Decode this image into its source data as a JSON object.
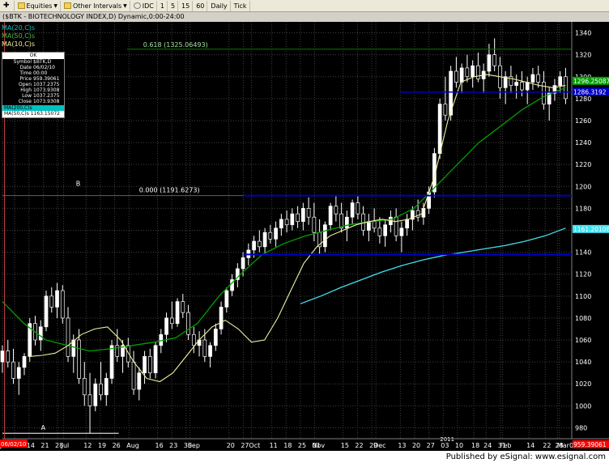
{
  "toolbar": {
    "items": [
      {
        "label": "",
        "icon": "plus-icon"
      },
      {
        "label": "Equities",
        "icon": "folder-icon"
      },
      {
        "label": "Other Intervals",
        "icon": "folder-icon"
      },
      {
        "label": "IDC",
        "icon": "settings-icon"
      },
      {
        "label": "1"
      },
      {
        "label": "5"
      },
      {
        "label": "15"
      },
      {
        "label": "60"
      },
      {
        "label": "Daily"
      },
      {
        "label": "Tick"
      }
    ]
  },
  "window": {
    "title": "($BTK - BIOTECHNOLOGY INDEX,D) Dynamic,0:00-24:00"
  },
  "legend": {
    "ma20": "MA(20,C)s",
    "ma50": "MA(50,C)s",
    "ma10": "MA(10,C)s"
  },
  "data_window": {
    "header": "OK",
    "rows": [
      {
        "k": "Symbol",
        "v": "$BTK,D"
      },
      {
        "k": "Date",
        "v": "06/02/10"
      },
      {
        "k": "Time",
        "v": "00:00"
      },
      {
        "k": "Price",
        "v": "959.39061"
      },
      {
        "k": "Open",
        "v": "1037.2375"
      },
      {
        "k": "High",
        "v": "1073.9308"
      },
      {
        "k": "Low",
        "v": "1037.2375"
      },
      {
        "k": "Close",
        "v": "1073.9308"
      }
    ],
    "ma50_head": "MA(200,C)s",
    "ma50_row": "MA(50,C)s  1163.15072"
  },
  "footer": {
    "text": "Published by eSignal: www.esignal.com"
  },
  "colors": {
    "background": "#000000",
    "grid": "#404040",
    "candle_up": "#ffffff",
    "candle_down": "#000000",
    "wick": "#ffffff",
    "ma10": "#f0f0a0",
    "ma50": "#00a000",
    "ma200": "#40e0f0",
    "fib_line": "#008000",
    "support_line": "#0000c0",
    "price_tag": "#ff0000"
  },
  "chart_data": {
    "type": "candlestick",
    "title": "$BTK - BIOTECHNOLOGY INDEX,D",
    "ylim": [
      970,
      1350
    ],
    "yticks": [
      980,
      1000,
      1020,
      1040,
      1060,
      1080,
      1100,
      1120,
      1140,
      1160,
      1180,
      1200,
      1220,
      1240,
      1260,
      1280,
      1300,
      1320,
      1340
    ],
    "x_labels": [
      {
        "date": "2010-06-01",
        "label": "Jun"
      },
      {
        "date": "2010-06-07",
        "label": "7"
      },
      {
        "date": "2010-06-14",
        "label": "14"
      },
      {
        "date": "2010-06-21",
        "label": "21"
      },
      {
        "date": "2010-06-28",
        "label": "28"
      },
      {
        "date": "2010-07-01",
        "label": "Jul"
      },
      {
        "date": "2010-07-12",
        "label": "12"
      },
      {
        "date": "2010-07-19",
        "label": "19"
      },
      {
        "date": "2010-07-26",
        "label": "26"
      },
      {
        "date": "2010-08-02",
        "label": "Aug"
      },
      {
        "date": "2010-08-16",
        "label": "16"
      },
      {
        "date": "2010-08-23",
        "label": "23"
      },
      {
        "date": "2010-08-30",
        "label": "30"
      },
      {
        "date": "2010-09-01",
        "label": "Sep"
      },
      {
        "date": "2010-09-20",
        "label": "20"
      },
      {
        "date": "2010-09-27",
        "label": "27"
      },
      {
        "date": "2010-10-01",
        "label": "Oct"
      },
      {
        "date": "2010-10-11",
        "label": "11"
      },
      {
        "date": "2010-10-18",
        "label": "18"
      },
      {
        "date": "2010-10-25",
        "label": "25"
      },
      {
        "date": "2010-11-01",
        "label": "01"
      },
      {
        "date": "2010-11-01",
        "label": "Nov"
      },
      {
        "date": "2010-11-15",
        "label": "15"
      },
      {
        "date": "2010-11-22",
        "label": "22"
      },
      {
        "date": "2010-11-29",
        "label": "29"
      },
      {
        "date": "2010-12-01",
        "label": "Dec"
      },
      {
        "date": "2010-12-13",
        "label": "13"
      },
      {
        "date": "2010-12-20",
        "label": "20"
      },
      {
        "date": "2010-12-27",
        "label": "27"
      },
      {
        "date": "2011-01-03",
        "label": "03"
      },
      {
        "date": "2011-01-10",
        "label": "10"
      },
      {
        "date": "2011-01-18",
        "label": "18"
      },
      {
        "date": "2011-01-24",
        "label": "24"
      },
      {
        "date": "2011-01-31",
        "label": "31"
      },
      {
        "date": "2011-02-01",
        "label": "Feb"
      },
      {
        "date": "2011-02-14",
        "label": "14"
      },
      {
        "date": "2011-02-22",
        "label": "22"
      },
      {
        "date": "2011-02-28",
        "label": "28"
      },
      {
        "date": "2011-03-01",
        "label": "Mar"
      },
      {
        "date": "2011-03-07",
        "label": "07"
      }
    ],
    "year_label": {
      "date": "2011-01-03",
      "label": "2011"
    },
    "date_range": [
      "2010-06-01",
      "2011-03-07"
    ],
    "ohlc": [
      [
        1040,
        1055,
        1030,
        1050
      ],
      [
        1050,
        1060,
        1035,
        1040
      ],
      [
        1040,
        1052,
        1020,
        1025
      ],
      [
        1025,
        1040,
        1010,
        1035
      ],
      [
        1035,
        1048,
        1028,
        1045
      ],
      [
        1045,
        1080,
        1040,
        1075
      ],
      [
        1075,
        1082,
        1055,
        1060
      ],
      [
        1060,
        1078,
        1050,
        1072
      ],
      [
        1072,
        1105,
        1068,
        1100
      ],
      [
        1100,
        1108,
        1085,
        1090
      ],
      [
        1090,
        1112,
        1080,
        1105
      ],
      [
        1105,
        1110,
        1075,
        1080
      ],
      [
        1080,
        1090,
        1040,
        1045
      ],
      [
        1045,
        1065,
        1030,
        1060
      ],
      [
        1060,
        1070,
        1020,
        1025
      ],
      [
        1025,
        1040,
        1000,
        1010
      ],
      [
        1010,
        1030,
        975,
        1000
      ],
      [
        1000,
        1025,
        995,
        1020
      ],
      [
        1020,
        1040,
        1005,
        1010
      ],
      [
        1010,
        1030,
        1000,
        1025
      ],
      [
        1025,
        1060,
        1020,
        1055
      ],
      [
        1055,
        1070,
        1040,
        1045
      ],
      [
        1045,
        1060,
        1030,
        1055
      ],
      [
        1055,
        1062,
        1035,
        1040
      ],
      [
        1040,
        1050,
        1010,
        1015
      ],
      [
        1015,
        1035,
        1005,
        1030
      ],
      [
        1030,
        1050,
        1020,
        1045
      ],
      [
        1045,
        1052,
        1025,
        1030
      ],
      [
        1030,
        1058,
        1025,
        1055
      ],
      [
        1055,
        1070,
        1048,
        1065
      ],
      [
        1065,
        1085,
        1058,
        1080
      ],
      [
        1080,
        1095,
        1070,
        1075
      ],
      [
        1075,
        1098,
        1072,
        1095
      ],
      [
        1095,
        1102,
        1080,
        1085
      ],
      [
        1085,
        1092,
        1060,
        1065
      ],
      [
        1065,
        1072,
        1048,
        1055
      ],
      [
        1055,
        1068,
        1045,
        1060
      ],
      [
        1060,
        1070,
        1040,
        1045
      ],
      [
        1045,
        1058,
        1035,
        1055
      ],
      [
        1055,
        1075,
        1050,
        1070
      ],
      [
        1070,
        1095,
        1065,
        1090
      ],
      [
        1090,
        1108,
        1085,
        1105
      ],
      [
        1105,
        1120,
        1100,
        1115
      ],
      [
        1115,
        1130,
        1108,
        1125
      ],
      [
        1125,
        1140,
        1118,
        1135
      ],
      [
        1135,
        1148,
        1128,
        1142
      ],
      [
        1142,
        1155,
        1135,
        1150
      ],
      [
        1150,
        1160,
        1140,
        1145
      ],
      [
        1145,
        1162,
        1138,
        1158
      ],
      [
        1158,
        1165,
        1148,
        1152
      ],
      [
        1152,
        1168,
        1145,
        1162
      ],
      [
        1162,
        1175,
        1155,
        1170
      ],
      [
        1170,
        1178,
        1158,
        1165
      ],
      [
        1165,
        1180,
        1160,
        1175
      ],
      [
        1175,
        1182,
        1162,
        1168
      ],
      [
        1168,
        1185,
        1160,
        1180
      ],
      [
        1180,
        1190,
        1165,
        1172
      ],
      [
        1172,
        1185,
        1150,
        1158
      ],
      [
        1158,
        1170,
        1138,
        1145
      ],
      [
        1145,
        1168,
        1140,
        1165
      ],
      [
        1165,
        1185,
        1160,
        1182
      ],
      [
        1182,
        1192,
        1168,
        1175
      ],
      [
        1175,
        1185,
        1158,
        1162
      ],
      [
        1162,
        1178,
        1150,
        1172
      ],
      [
        1172,
        1188,
        1165,
        1185
      ],
      [
        1185,
        1192,
        1170,
        1175
      ],
      [
        1175,
        1182,
        1155,
        1160
      ],
      [
        1160,
        1175,
        1150,
        1168
      ],
      [
        1168,
        1180,
        1158,
        1162
      ],
      [
        1162,
        1172,
        1148,
        1155
      ],
      [
        1155,
        1170,
        1145,
        1165
      ],
      [
        1165,
        1178,
        1158,
        1172
      ],
      [
        1172,
        1180,
        1150,
        1155
      ],
      [
        1155,
        1168,
        1140,
        1162
      ],
      [
        1162,
        1175,
        1155,
        1170
      ],
      [
        1170,
        1182,
        1160,
        1178
      ],
      [
        1178,
        1188,
        1168,
        1172
      ],
      [
        1172,
        1185,
        1165,
        1180
      ],
      [
        1180,
        1200,
        1175,
        1195
      ],
      [
        1195,
        1235,
        1190,
        1230
      ],
      [
        1230,
        1280,
        1225,
        1275
      ],
      [
        1275,
        1300,
        1260,
        1265
      ],
      [
        1265,
        1310,
        1260,
        1305
      ],
      [
        1305,
        1318,
        1290,
        1295
      ],
      [
        1295,
        1312,
        1285,
        1308
      ],
      [
        1308,
        1320,
        1295,
        1300
      ],
      [
        1300,
        1315,
        1290,
        1310
      ],
      [
        1310,
        1322,
        1295,
        1298
      ],
      [
        1298,
        1312,
        1285,
        1305
      ],
      [
        1305,
        1330,
        1300,
        1320
      ],
      [
        1320,
        1335,
        1305,
        1310
      ],
      [
        1310,
        1318,
        1280,
        1290
      ],
      [
        1290,
        1305,
        1275,
        1300
      ],
      [
        1300,
        1310,
        1285,
        1292
      ],
      [
        1292,
        1302,
        1280,
        1295
      ],
      [
        1295,
        1305,
        1282,
        1288
      ],
      [
        1288,
        1300,
        1275,
        1295
      ],
      [
        1295,
        1308,
        1288,
        1302
      ],
      [
        1302,
        1310,
        1290,
        1295
      ],
      [
        1295,
        1305,
        1270,
        1275
      ],
      [
        1275,
        1290,
        1260,
        1285
      ],
      [
        1285,
        1298,
        1278,
        1292
      ],
      [
        1292,
        1305,
        1285,
        1300
      ],
      [
        1300,
        1308,
        1275,
        1280
      ]
    ],
    "ma10_values": [
      1045,
      1046,
      1048,
      1055,
      1065,
      1070,
      1072,
      1060,
      1040,
      1025,
      1022,
      1030,
      1045,
      1060,
      1072,
      1078,
      1070,
      1058,
      1060,
      1080,
      1105,
      1130,
      1145,
      1155,
      1160,
      1165,
      1168,
      1170,
      1168,
      1170,
      1175,
      1210,
      1260,
      1295,
      1300,
      1302,
      1300,
      1298,
      1295,
      1292,
      1290,
      1292
    ],
    "ma50_values": [
      1095,
      1075,
      1060,
      1055,
      1050,
      1052,
      1055,
      1058,
      1062,
      1075,
      1100,
      1120,
      1138,
      1148,
      1155,
      1160,
      1165,
      1168,
      1170,
      1180,
      1200,
      1220,
      1240,
      1255,
      1270,
      1282,
      1290
    ],
    "ma200_values": [
      1093,
      1100,
      1108,
      1115,
      1122,
      1128,
      1133,
      1137,
      1140,
      1143,
      1146,
      1150,
      1155,
      1162
    ],
    "ma200_start_date": "2010-10-25",
    "annotations": [
      {
        "label": "0.618 (1325.06493)",
        "y": 1325.06493,
        "type": "fib"
      },
      {
        "label": "0.000 (1191.6273)",
        "y": 1191.6273,
        "type": "fib"
      },
      {
        "label": "A",
        "y": 975,
        "type": "marker"
      },
      {
        "label": "B",
        "y": 1191.6273,
        "type": "marker"
      }
    ],
    "support_lines": [
      1138,
      1191.6273,
      1286
    ],
    "price_tags": [
      {
        "label": "1296.25087",
        "y": 1296.25087,
        "color": "#00a000"
      },
      {
        "label": "1286.3192",
        "y": 1286.3192,
        "color": "#0000c0"
      },
      {
        "label": "1161.20108",
        "y": 1161.20108,
        "color": "#40e0f0"
      },
      {
        "label": "959.39061",
        "y": 965,
        "color": "#ff0000"
      }
    ],
    "cursor_date_label": "06/02/10"
  }
}
